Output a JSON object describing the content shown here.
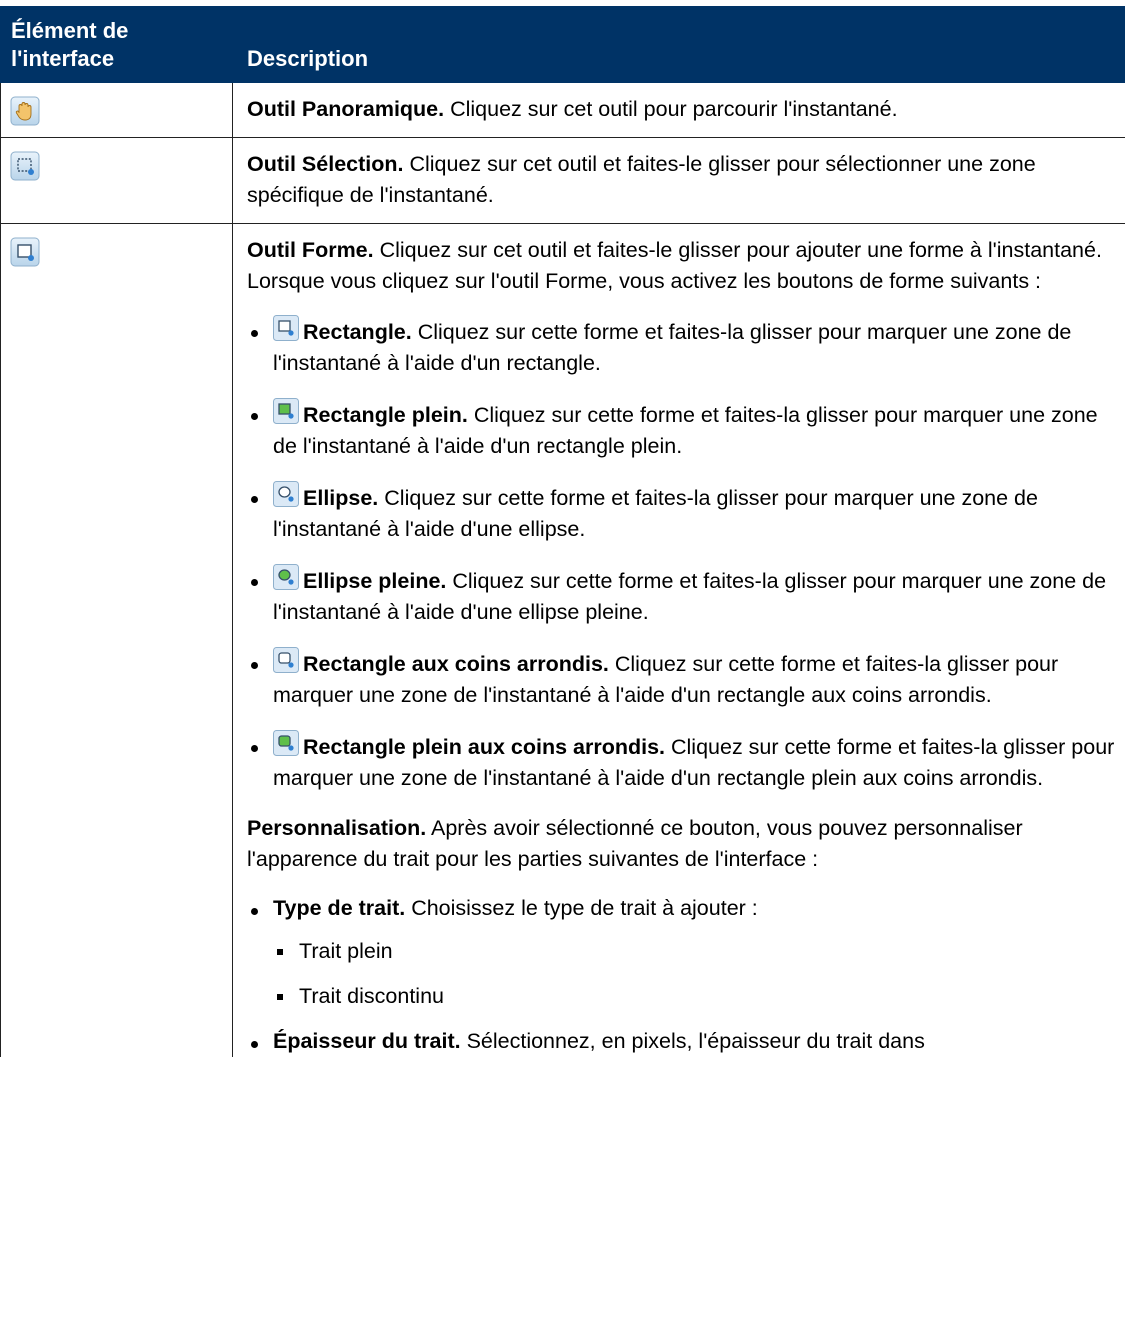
{
  "table": {
    "header": {
      "col1": "Élément de l'interface",
      "col2": "Description"
    },
    "rows": {
      "pan": {
        "icon": "hand-pan-icon",
        "title": "Outil Panoramique.",
        "text": " Cliquez sur cet outil pour parcourir l'instantané."
      },
      "select": {
        "icon": "selection-tool-icon",
        "title": "Outil Sélection.",
        "text": " Cliquez sur cet outil et faites-le glisser pour sélectionner une zone spécifique de l'instantané."
      },
      "shape": {
        "icon": "shape-tool-icon",
        "title": "Outil Forme.",
        "text": " Cliquez sur cet outil et faites-le glisser pour ajouter une forme à l'instantané. Lorsque vous cliquez sur l'outil Forme, vous activez les boutons de forme suivants :",
        "shapes": [
          {
            "icon": "rectangle-icon",
            "title": "Rectangle.",
            "text": " Cliquez sur cette forme et faites-la glisser pour marquer une zone de l'instantané à l'aide d'un rectangle."
          },
          {
            "icon": "filled-rectangle-icon",
            "title": "Rectangle plein.",
            "text": " Cliquez sur cette forme et faites-la glisser pour marquer une zone de l'instantané à l'aide d'un rectangle plein."
          },
          {
            "icon": "ellipse-icon",
            "title": "Ellipse.",
            "text": " Cliquez sur cette forme et faites-la glisser pour marquer une zone de l'instantané à l'aide d'une ellipse."
          },
          {
            "icon": "filled-ellipse-icon",
            "title": "Ellipse pleine.",
            "text": " Cliquez sur cette forme et faites-la glisser pour marquer une zone de l'instantané à l'aide d'une ellipse pleine."
          },
          {
            "icon": "rounded-rectangle-icon",
            "title": "Rectangle aux coins arrondis.",
            "text": " Cliquez sur cette forme et faites-la glisser pour marquer une zone de l'instantané à l'aide d'un rectangle aux coins arrondis."
          },
          {
            "icon": "filled-rounded-rectangle-icon",
            "title": "Rectangle plein aux coins arrondis.",
            "text": " Cliquez sur cette forme et faites-la glisser pour marquer une zone de l'instantané à l'aide d'un rectangle plein aux coins arrondis."
          }
        ],
        "custom": {
          "title": "Personnalisation.",
          "text": " Après avoir sélectionné ce bouton, vous pouvez personnaliser l'apparence du trait pour les parties suivantes de l'interface :",
          "items": [
            {
              "title": "Type de trait.",
              "text": " Choisissez le type de trait à ajouter :",
              "options": [
                "Trait plein",
                "Trait discontinu"
              ]
            },
            {
              "title": "Épaisseur du trait.",
              "text": " Sélectionnez, en pixels, l'épaisseur du trait dans"
            }
          ]
        }
      }
    }
  },
  "colors": {
    "header_bg": "#003366",
    "header_text": "#ffffff",
    "border": "#222222"
  }
}
